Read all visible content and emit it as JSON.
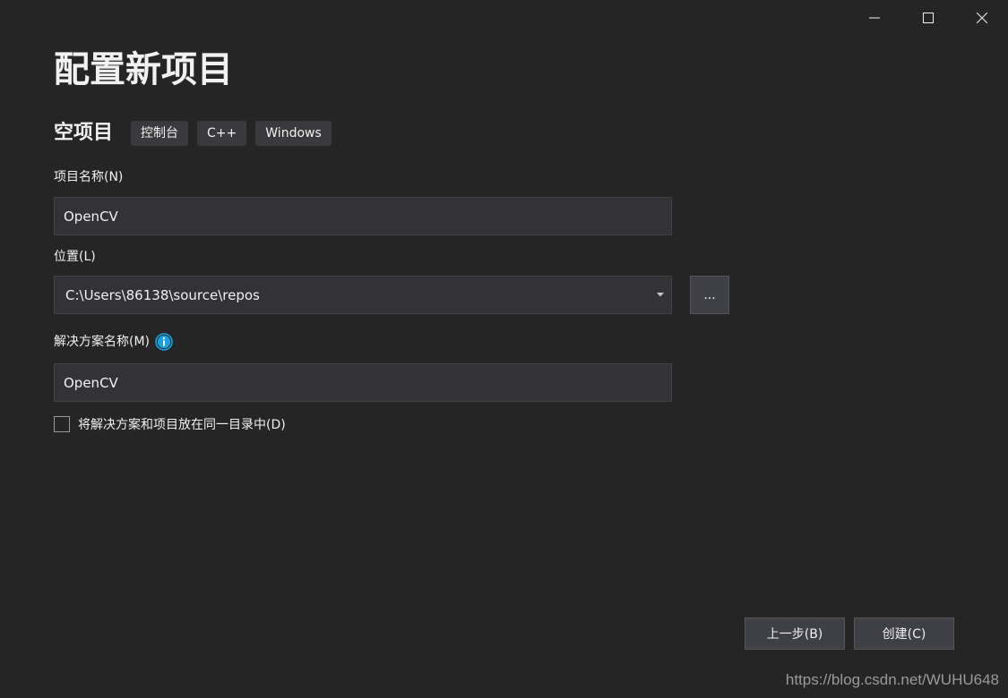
{
  "window_controls": {
    "minimize": "minimize",
    "maximize": "maximize",
    "close": "close"
  },
  "page": {
    "title": "配置新项目"
  },
  "template": {
    "name": "空项目",
    "tags": [
      "控制台",
      "C++",
      "Windows"
    ]
  },
  "fields": {
    "project_name_label": "项目名称(N)",
    "project_name_value": "OpenCV",
    "location_label": "位置(L)",
    "location_value": "C:\\Users\\86138\\source\\repos",
    "browse_label": "...",
    "solution_name_label": "解决方案名称(M)",
    "solution_name_value": "OpenCV",
    "same_dir_label": "将解决方案和项目放在同一目录中(D)",
    "same_dir_checked": false
  },
  "footer": {
    "back_label": "上一步(B)",
    "create_label": "创建(C)"
  },
  "watermark": "https://blog.csdn.net/WUHU648",
  "colors": {
    "background": "#252526",
    "input_bg": "#333337",
    "tag_bg": "#3a3a3d",
    "button_bg": "#3f3f46",
    "info_icon": "#1ba1e2",
    "text": "#f1f1f1"
  }
}
